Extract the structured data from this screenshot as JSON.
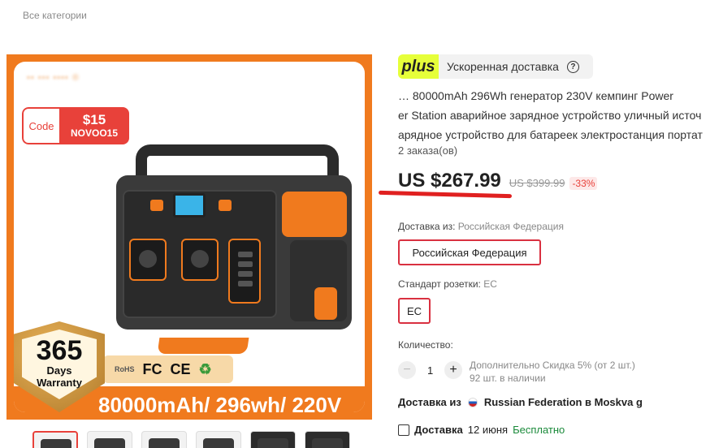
{
  "breadcrumb": "Все категории",
  "image": {
    "brand_blur": "•• ••• •••• ®",
    "coupon": {
      "code_label": "Code",
      "amount": "$15",
      "name": "NOVOO15"
    },
    "warranty": {
      "number": "365",
      "days": "Days",
      "word": "Warranty"
    },
    "certs": {
      "rohs": "RoHS",
      "fc": "FC",
      "ce": "CE",
      "recycle": "♻"
    },
    "banner": "80000mAh/ 296wh/ 220V",
    "thumbnail_count": 6
  },
  "plus": {
    "logo": "plus",
    "text": "Ускоренная доставка",
    "help": "?"
  },
  "title_lines": [
    "… 80000mAh 296Wh генератор 230V кемпинг Power",
    "er Station аварийное зарядное устройство уличный источ",
    "арядное устройство для батареек электростанция портат"
  ],
  "orders": "2 заказа(ов)",
  "price": {
    "current": "US $267.99",
    "old": "US $399.99",
    "discount": "-33%"
  },
  "ship_from": {
    "label": "Доставка из:",
    "value": "Российская Федерация",
    "option": "Российская Федерация"
  },
  "socket": {
    "label": "Стандарт розетки:",
    "value": "EC",
    "option": "EC"
  },
  "quantity": {
    "label": "Количество:",
    "minus": "−",
    "value": "1",
    "plus": "+",
    "note1": "Дополнительно Скидка 5% (от 2 шт.)",
    "note2": "92 шт. в наличии"
  },
  "shipping": {
    "prefix": "Доставка из",
    "route": "Russian Federation в Moskva g"
  },
  "delivery": {
    "label": "Доставка",
    "date": "12 июня",
    "price": "Бесплатно"
  }
}
